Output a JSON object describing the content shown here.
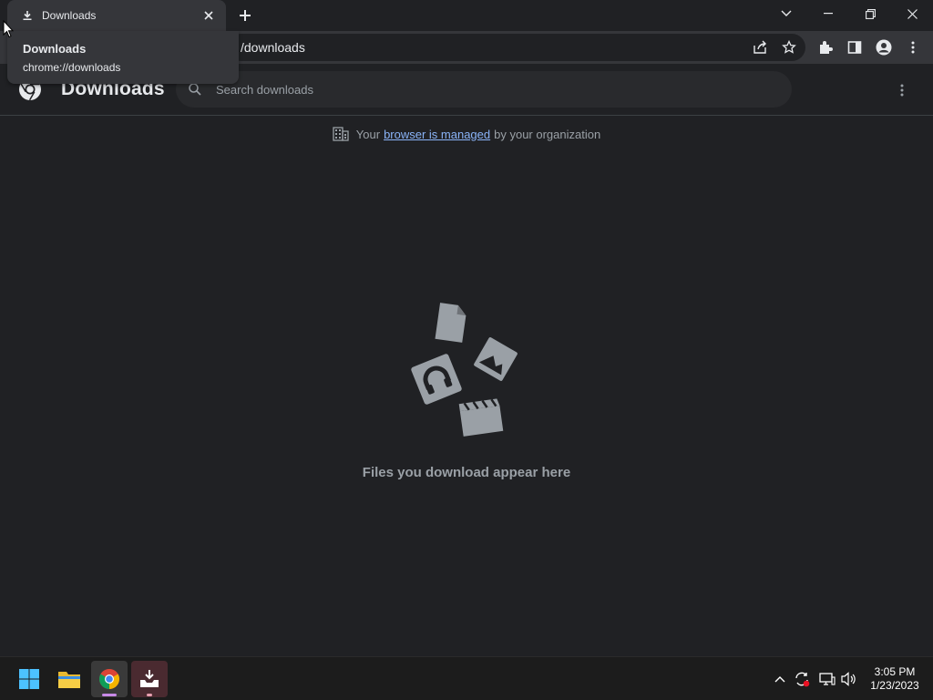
{
  "tab": {
    "title": "Downloads",
    "close_label": "×"
  },
  "hovercard": {
    "title": "Downloads",
    "url": "chrome://downloads"
  },
  "omnibox": {
    "text": "/downloads"
  },
  "page": {
    "title": "Downloads",
    "search_placeholder": "Search downloads"
  },
  "managed": {
    "prefix": "Your",
    "link": "browser is managed",
    "suffix": "by your organization"
  },
  "empty_state": {
    "message": "Files you download appear here"
  },
  "taskbar": {
    "time": "3:05 PM",
    "date": "1/23/2023"
  },
  "colors": {
    "background": "#202124",
    "toolbar": "#35363a",
    "link": "#8ab4f8",
    "muted": "#9aa0a6",
    "illustration": "#9aa0a6"
  },
  "icons": {
    "tab": "download-icon",
    "new_tab": "plus-icon",
    "share": "share-icon",
    "bookmark": "star-icon",
    "extensions": "puzzle-icon",
    "side_panel": "side-panel-icon",
    "profile": "person-icon",
    "menu": "kebab-icon",
    "search": "search-icon",
    "building": "building-icon"
  }
}
